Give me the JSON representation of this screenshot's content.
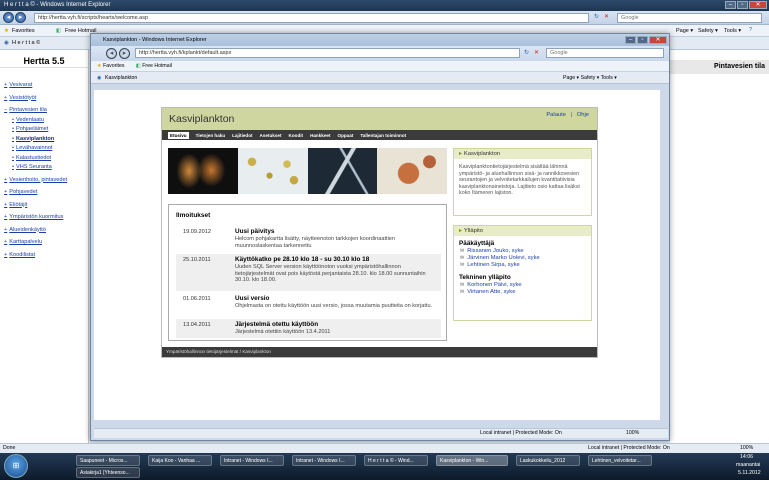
{
  "outer": {
    "title": "H e r t t a © - Windows Internet Explorer",
    "address": "http://hertta.vyh.fi/scripts/hearts/welcome.asp",
    "search_placeholder": "Google",
    "fav_favorites": "Favorites",
    "fav_hotmail": "Free Hotmail",
    "tab_label": "H e r t t a ©",
    "toolbar_page": "Page ▾",
    "toolbar_safety": "Safety ▾",
    "toolbar_tools": "Tools ▾",
    "status_left": "Done",
    "status_zone": "Local intranet | Protected Mode: On",
    "zoom": "100%"
  },
  "sidebar": {
    "title": "Hertta 5.5",
    "items": [
      {
        "label": "Vesivarat",
        "mark": "+"
      },
      {
        "label": "Vesistötyöt",
        "mark": "+"
      },
      {
        "label": "Pintavesien tila",
        "mark": "−"
      }
    ],
    "subitems": [
      "Vedenlaatu",
      "Pohjaeläimet",
      "Kasviplankton",
      "Levähavainnot",
      "Kalastustiedot",
      "VHS Seuranta"
    ],
    "items2": [
      {
        "label": "Vesienhoito, pintavedet",
        "mark": "+"
      },
      {
        "label": "Pohjavedet",
        "mark": "+"
      },
      {
        "label": "Eliötäjit",
        "mark": "+"
      },
      {
        "label": "Ympäristön kuormitus",
        "mark": "+"
      },
      {
        "label": "Alueidenkäyttö",
        "mark": "+"
      },
      {
        "label": "Karttapalvelu",
        "mark": "+"
      },
      {
        "label": "Koodilistat",
        "mark": "+"
      }
    ]
  },
  "right_strip": {
    "title": "Pintavesien tila"
  },
  "inner": {
    "title": "Kasviplankton - Windows Internet Explorer",
    "address": "http://hertta.vyh.fi/kplankt/default.aspx",
    "search_placeholder": "Google",
    "fav_favorites": "Favorites",
    "fav_hotmail": "Free Hotmail",
    "tab_label": "Kasviplankton",
    "toolbar": "Page ▾  Safety ▾  Tools ▾",
    "status_zone": "Local intranet | Protected Mode: On",
    "zoom": "100%"
  },
  "page": {
    "title": "Kasviplankton",
    "toplink_help": "Palaute",
    "toplink_sep": "|",
    "toplink_guide": "Ohje",
    "nav": [
      "Etusivu",
      "Tietojen haku",
      "Lajitiedot",
      "Asetukset",
      "Koodit",
      "Hankkeet",
      "Oppaat",
      "Tallentajan toiminnot"
    ],
    "announcements_title": "Ilmoitukset",
    "announcements": [
      {
        "date": "19.09.2012",
        "title": "Uusi päivitys",
        "body": "Helcom pohjakartta lisätty, näytteenoton tarkkojen koordinaattien muunnoslaskentaa tarkennettu"
      },
      {
        "date": "25.10.2011",
        "title": "Käyttökatko pe 28.10 klo 18 - su 30.10 klo 18",
        "body": "Uuden SQL Server version käyttöönoton vuoksi ympäristöhallinnon tietojärjestelmät ovat pois käytöstä perjantaista 28.10. klo 18.00 sunnuntaihin 30.10. klo 18.00."
      },
      {
        "date": "01.06.2011",
        "title": "Uusi versio",
        "body": "Ohjelmasta on otettu käyttöön uusi versio, jossa muutamia puutteita on korjattu."
      },
      {
        "date": "13.04.2011",
        "title": "Järjestelmä otettu käyttöön",
        "body": "Järjestelmä otettiin käyttöön 13.4.2011"
      }
    ],
    "box1_title": "Kasviplankton",
    "box1_text": "Kasviplanktontietojärjestelmä sisältää lähinnä ympäristö- ja aluehallinnon sisä- ja rannikkovesien seurantojen ja velvoitetarkkailujen kvantitatiivisia kasviplanktonaineistoja. Lajitieto osio kattaa lisäksi koko Itämeren lajiston.",
    "box2_title": "Ylläpito",
    "admin_title": "Pääkäyttäjä",
    "admins": [
      "Rissanen Jouko, syke",
      "Järvinen Marko Uolevi, syke",
      "Lehtinen Sirpa, syke"
    ],
    "tech_title": "Tekninen ylläpito",
    "techs": [
      "Korhonen Päivi, syke",
      "Virtanen Atte, syke"
    ],
    "footer": "Ympäristöhallinnon tietojärjestelmät / Kasviplankton"
  },
  "taskbar": {
    "items": [
      "Saapuneet - Micros...",
      "Kaija Koo - Vanhaa ...",
      "Intranet - Windows I...",
      "Intranet - Windows I...",
      "H e r t t a © - Wind...",
      "Kasviplankton - Win...",
      "Laskukokkeilu_2012",
      "Lehtinen_velvoitetar..."
    ],
    "item_row2": "Asiakirja1 [Yhteenso...",
    "time": "14:06",
    "day": "maanantai",
    "date": "5.11.2012"
  }
}
